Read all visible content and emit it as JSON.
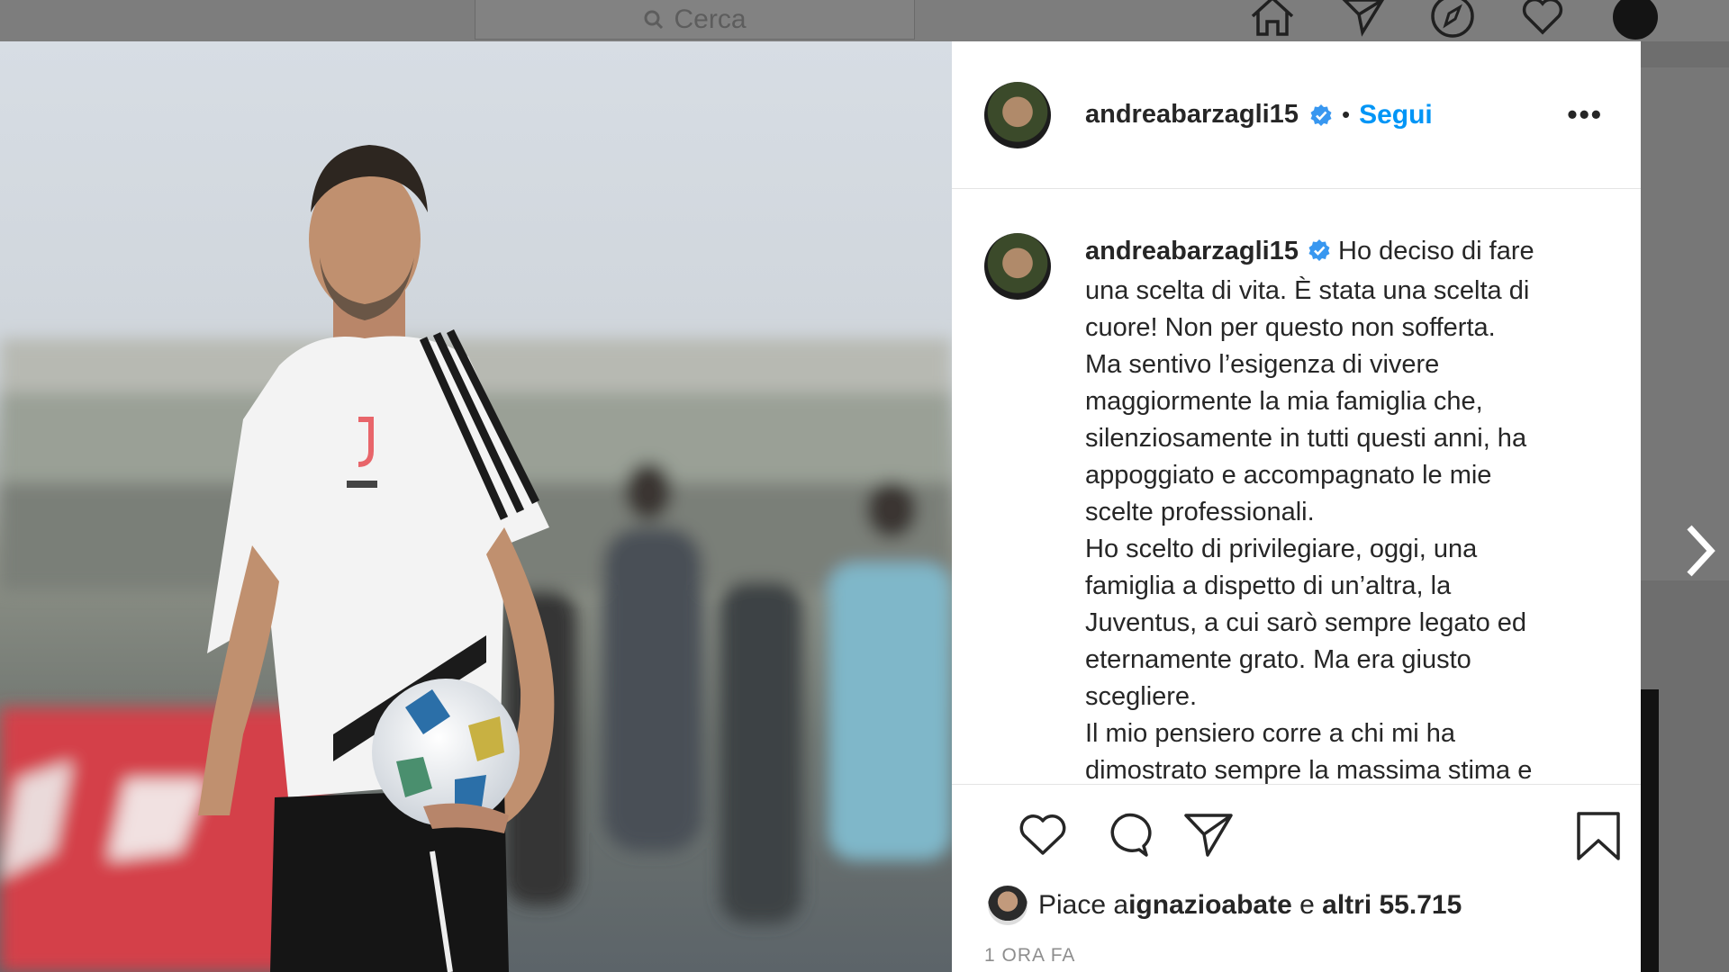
{
  "topbar": {
    "search_placeholder": "Cerca",
    "icons": [
      "home-icon",
      "direct-icon",
      "explore-icon",
      "activity-icon",
      "profile-avatar"
    ]
  },
  "post": {
    "photo_alt": "Calciatore con pallone in allenamento",
    "author": "andreabarzagli15",
    "verified": true,
    "separator": "•",
    "follow_label": "Segui",
    "more_label": "•••",
    "caption_author": "andreabarzagli15",
    "caption_text": " Ho deciso di fare\nuna scelta di vita. È stata una scelta di\ncuore! Non per questo non sofferta.\nMa sentivo l’esigenza di vivere\nmaggiormente la mia famiglia che,\nsilenziosamente in tutti questi anni, ha\nappoggiato e accompagnato le mie\nscelte professionali.\nHo scelto di privilegiare, oggi, una\nfamiglia a dispetto di un’altra, la\nJuventus, a cui sarò sempre legato ed\neternamente grato. Ma era giusto\nscegliere.\nIl mio pensiero corre a chi mi ha\ndimostrato sempre la massima stima e",
    "likes_prefix": "Piace a ",
    "likes_user": "ignazioabate",
    "likes_middle": " e ",
    "likes_count": "altri 55.715",
    "timestamp": "1 ORA FA"
  },
  "colors": {
    "accent": "#0095f6",
    "verified": "#3897f0",
    "text": "#262626",
    "muted": "#8e8e8e"
  }
}
